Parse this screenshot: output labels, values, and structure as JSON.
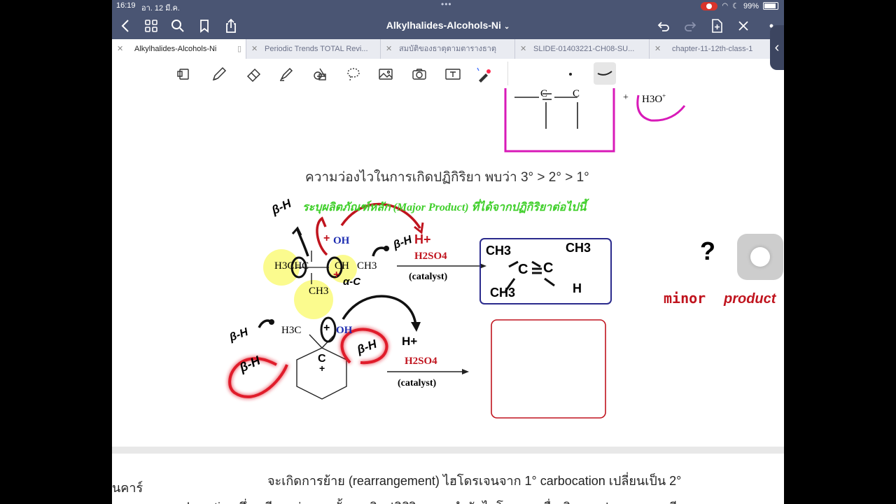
{
  "status": {
    "time": "16:19",
    "date": "อา. 12 มี.ค.",
    "battery": "99%",
    "battery_level": 0.99
  },
  "nav": {
    "title": "Alkylhalides-Alcohols-Ni"
  },
  "tabs": [
    {
      "label": "Alkylhalides-Alcohols-Ni",
      "active": true
    },
    {
      "label": "Periodic Trends TOTAL Revi..."
    },
    {
      "label": "สมบัติของธาตุตามตารางธาตุ"
    },
    {
      "label": "SLIDE-01403221-CH08-SU..."
    },
    {
      "label": "chapter-11-12th-class-1"
    }
  ],
  "icons": {
    "back": "chevron-left-icon",
    "grid": "grid-icon",
    "search": "search-icon",
    "bookmark": "bookmark-icon",
    "share": "share-icon",
    "undo": "undo-icon",
    "redo": "redo-icon",
    "add_page": "add-page-icon",
    "close": "close-icon",
    "more": "more-icon"
  },
  "colors": {
    "nav_bg": "#4a5573",
    "magenta_ink": "#d81ab8",
    "red_ink": "#c0141e",
    "navy_box": "#2a2a8c",
    "green_text": "#3fcf2a",
    "highlight_yellow": "#fafa7a"
  },
  "page": {
    "top_text": {
      "h3o": "H3O",
      "plus": "+"
    },
    "reactivity_line": "ความว่องไวในการเกิดปฏิกิริยา พบว่า 3° > 2° > 1°",
    "instruction": "ระบุผลิตภัณฑ์หลัก (Major Product) ที่ได้จากปฏิกิริยาต่อไปนี้",
    "reaction1": {
      "left_group": "H3CHC",
      "center": "CH",
      "right_group": "CH3",
      "bottom_group": "CH3",
      "oh": "OH",
      "reagent": "H2SO4",
      "condition": "(catalyst)"
    },
    "reaction2": {
      "methyl": "H3C",
      "oh": "OH",
      "reagent": "H2SO4",
      "condition": "(catalyst)"
    },
    "handwriting": {
      "beta_h_1": "β-H",
      "beta_h_2": "β-H",
      "beta_h_3": "β-H",
      "beta_h_4": "β-H",
      "beta_h_5": "β-H",
      "h_plus_1": "H+",
      "h_plus_2": "H+",
      "alpha_c": "α-C",
      "product_ch3_a": "CH3",
      "product_ch3_b": "CH3",
      "product_ch3_c": "CH3",
      "product_h": "H",
      "product_c1": "C",
      "product_c2": "C",
      "question": "?",
      "minor": "minor",
      "product": "product"
    }
  },
  "next_page": {
    "line1": "จะเกิดการย้าย (rearrangement) ไฮโดรเจนจาก 1°  carbocation  เปลี่ยนเป็น 2°",
    "line2": "carbocation ซึ่งเสถียรกว่า จากนั้นจะเกิดปฏิกิริยาการกำจัดไฮโดรเจนเพื่อเกิดสารประกอบแอลคีน",
    "left_fragment": "นคาร์"
  }
}
